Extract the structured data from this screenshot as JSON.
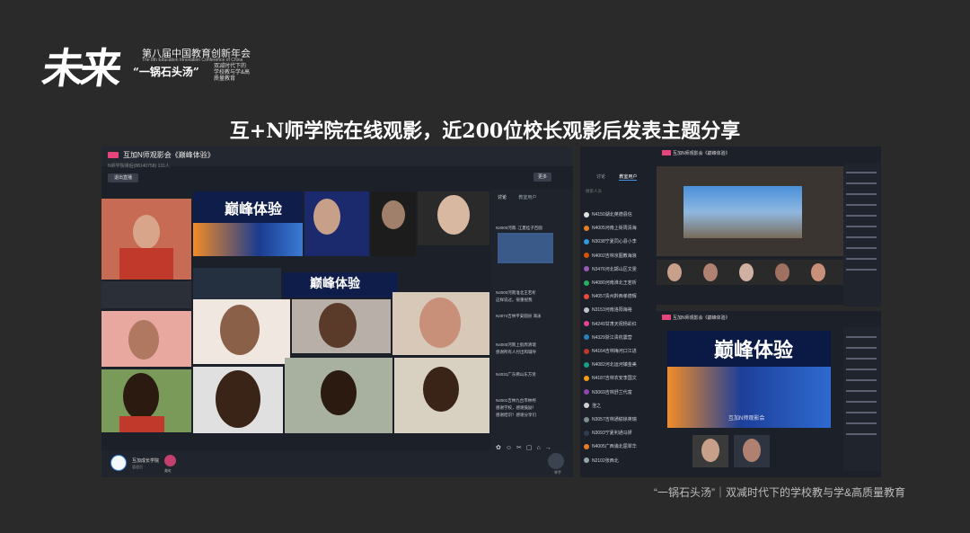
{
  "logo": {
    "mark": "未来"
  },
  "conference": {
    "title": "第八届中国教育创新年会",
    "subtitle": "The 8th Education Innovation Conference of China",
    "tagline": "“一锅石头汤”",
    "tagline2": "双减时代下的学校教与学&高质量教育"
  },
  "headline": "互+N师学院在线观影，近200位校长观影后发表主题分享",
  "footer_caption": "“一锅石头汤”｜双减时代下的学校教与学&高质量教育",
  "left_app": {
    "title": "互加N师观影会《巅峰体验》",
    "meta": "N师学院课后(88140758)    131人",
    "exit_label": "退出直播",
    "more_label": "更多",
    "chat_tabs": [
      "讨论",
      "教室用户"
    ],
    "chat_messages": [
      "N3000河南..江夏桂子百圆",
      "N4000河南淮北王若析",
      "这样说过。很重视我",
      "N3074吉林平安圆县 海泳",
      "N4000河南上街周清瑞",
      "感谢所有人付出和辅导",
      "N4031广东佛山东方贤",
      "N4001吉林九台市林柯",
      "感谢学校，感谢鼓励！",
      "感谢结识！感谢分享们"
    ],
    "org_name": "互加成长学院",
    "org_sub": "管理员",
    "mini_user": "美虹",
    "hand_label": "举手",
    "video_banner": "巅峰体验"
  },
  "mid_panel": {
    "tabs": [
      "讨论",
      "教室用户"
    ],
    "search_placeholder": "搜索人员",
    "users": [
      "N4150湖北英德县信",
      "N4005河南上街周清海",
      "N3038宁夏同心县小李",
      "N4002吉林京图教海浪",
      "N3476河北邯山区文雯",
      "N4080河南淮北王若析",
      "N4057贵州黔西孝德辉",
      "N3153河南洛阳海裕",
      "N4249甘肃天祝杨彩红",
      "N4329浙江贵杭震营",
      "N4164吉林梅河口江进",
      "N4082河北运河镇金美",
      "N4187吉林农安李国文",
      "N3069吉林舒兰代富",
      "澄之",
      "N3057吉林通榆徐英瑞",
      "N3093宁夏利通马妍",
      "N4005广西浦北屈翠华",
      "N2102张西北"
    ],
    "dot_colors": [
      "#e0e0e0",
      "#e67e22",
      "#3498db",
      "#d35400",
      "#9b59b6",
      "#27ae60",
      "#e74c3c",
      "#bdc3c7",
      "#e84393",
      "#2980b9",
      "#c0392b",
      "#16a085",
      "#f39c12",
      "#8e44ad",
      "#d0d0d0",
      "#7f8c8d",
      "#2c3e50",
      "#e67e22",
      "#95a5a6"
    ]
  },
  "right_top": {
    "title": "互加N师观影会《巅峰体验》"
  },
  "right_bottom": {
    "title": "互加N师观影会《巅峰体验》",
    "banner": "巅峰体验",
    "caption": "互加N师观影会"
  }
}
